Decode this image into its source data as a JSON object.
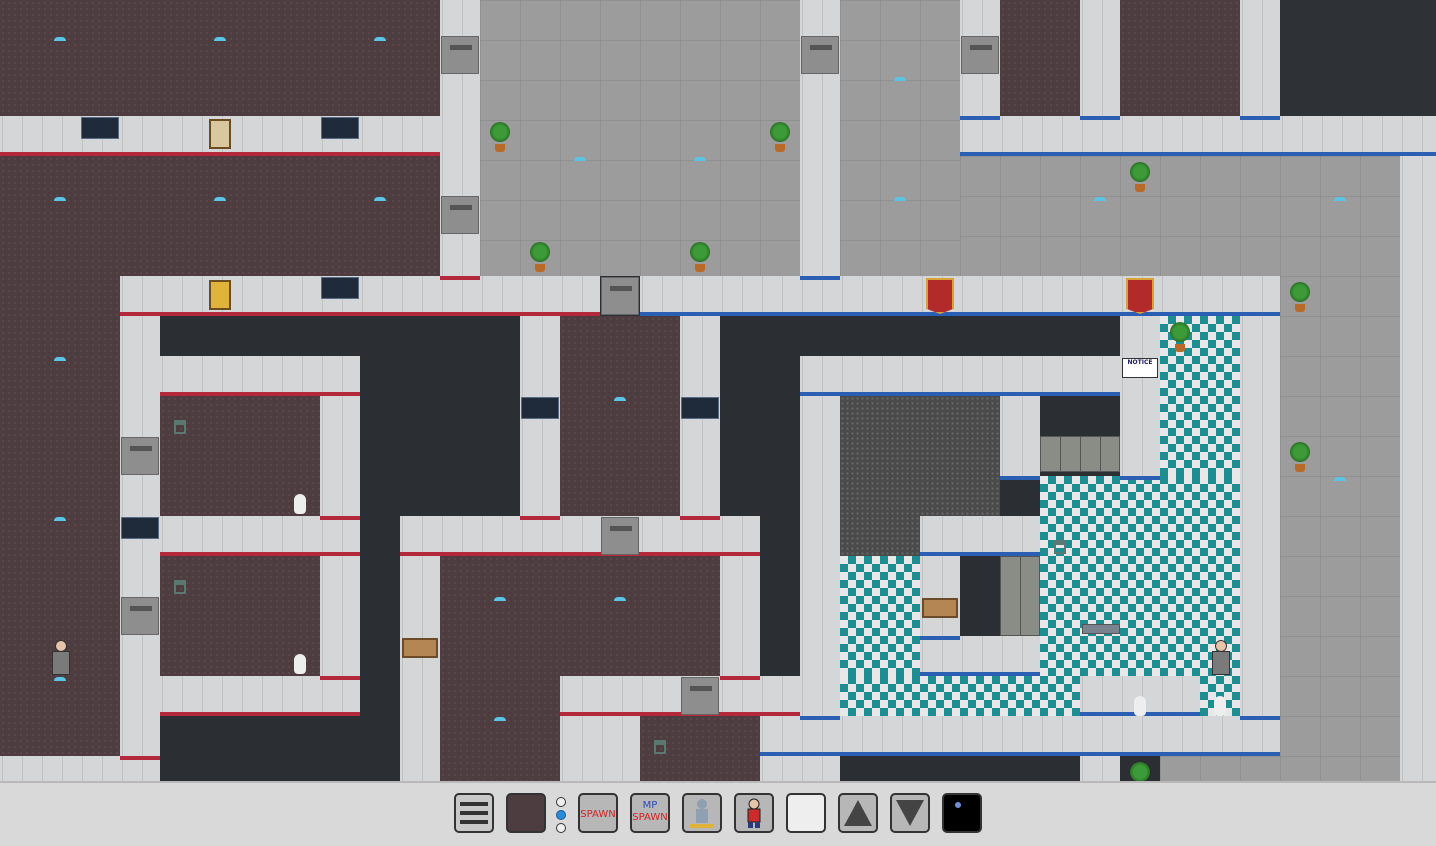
{
  "map": {
    "notice_sign": {
      "title": "NOTICE",
      "subtitle": ""
    }
  },
  "hotbar": {
    "menu_icon": "hamburger-menu-icon",
    "spawn_label": "SPAWN",
    "mp_label": "MP",
    "mp_spawn_label": "SPAWN",
    "layer_selected": 1,
    "label_color": "#d22222",
    "slots": [
      "menu",
      "carpet-tile",
      "layer-selector",
      "spawn",
      "mp-spawn",
      "ghost",
      "player",
      "blank",
      "rotate-up",
      "rotate-down",
      "space"
    ]
  }
}
